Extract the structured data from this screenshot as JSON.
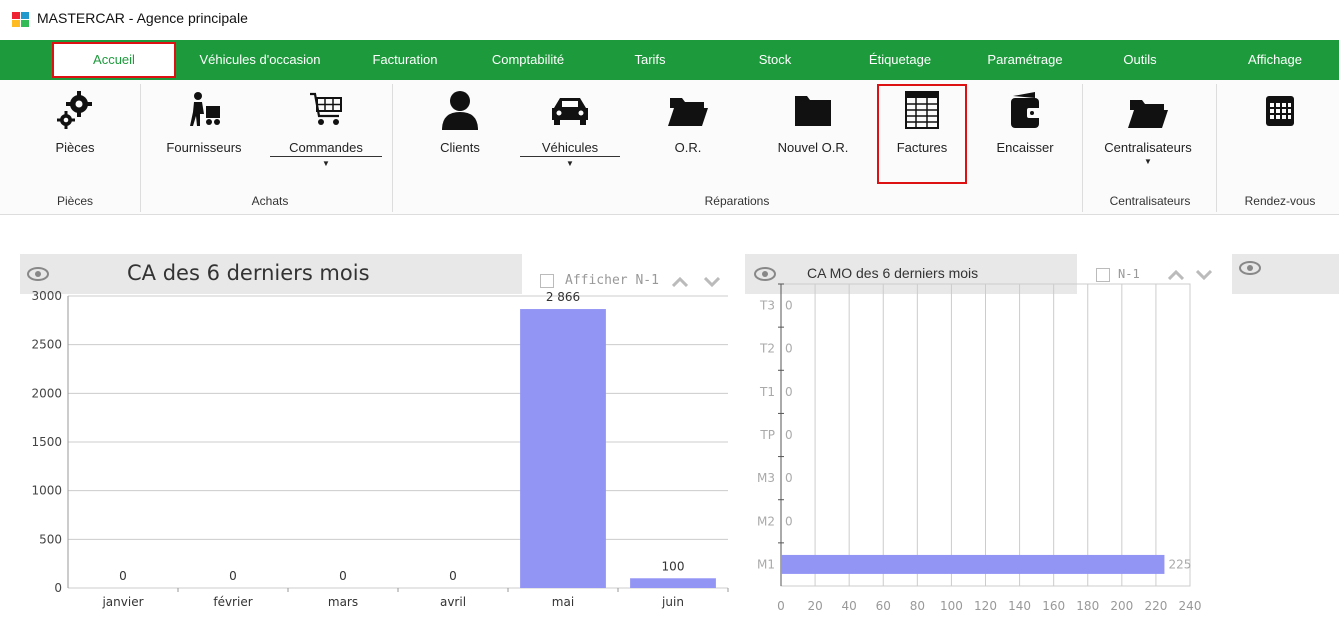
{
  "window": {
    "title": "MASTERCAR - Agence principale"
  },
  "menu": {
    "items": [
      "Accueil",
      "Véhicules d'occasion",
      "Facturation",
      "Comptabilité",
      "Tarifs",
      "Stock",
      "Étiquetage",
      "Paramétrage",
      "Outils",
      "Affichage"
    ],
    "active": "Accueil"
  },
  "ribbon": {
    "buttons": {
      "pieces": "Pièces",
      "fournisseurs": "Fournisseurs",
      "commandes": "Commandes",
      "clients": "Clients",
      "vehicules": "Véhicules",
      "or": "O.R.",
      "nouvel_or": "Nouvel O.R.",
      "factures": "Factures",
      "encaisser": "Encaisser",
      "centralisateurs": "Centralisateurs"
    },
    "groups": {
      "pieces": "Pièces",
      "achats": "Achats",
      "reparations": "Réparations",
      "centralisateurs": "Centralisateurs",
      "rendezvous": "Rendez-vous"
    }
  },
  "panel_ca": {
    "title": "CA des 6 derniers mois",
    "compare_label": "Afficher N-1"
  },
  "panel_mo": {
    "title": "CA MO des 6 derniers mois",
    "compare_label": "N-1"
  },
  "chart_data": [
    {
      "type": "bar",
      "title": "CA des 6 derniers mois",
      "categories": [
        "janvier",
        "février",
        "mars",
        "avril",
        "mai",
        "juin"
      ],
      "values": [
        0,
        0,
        0,
        0,
        2866,
        100
      ],
      "value_labels": [
        "0",
        "0",
        "0",
        "0",
        "2 866",
        "100"
      ],
      "ylim": [
        0,
        3000
      ],
      "yticks": [
        0,
        500,
        1000,
        1500,
        2000,
        2500,
        3000
      ],
      "grid": true,
      "bar_color": "#9395f5"
    },
    {
      "type": "bar",
      "orientation": "horizontal",
      "title": "CA MO des 6 derniers mois",
      "categories": [
        "T3",
        "T2",
        "T1",
        "TP",
        "M3",
        "M2",
        "M1"
      ],
      "values": [
        0,
        0,
        0,
        0,
        0,
        0,
        225
      ],
      "value_labels": [
        "0",
        "0",
        "0",
        "0",
        "0",
        "0",
        "225"
      ],
      "xlim": [
        0,
        240
      ],
      "xticks": [
        0,
        20,
        40,
        60,
        80,
        100,
        120,
        140,
        160,
        180,
        200,
        220,
        240
      ],
      "grid": true,
      "bar_color": "#9395f5"
    }
  ]
}
